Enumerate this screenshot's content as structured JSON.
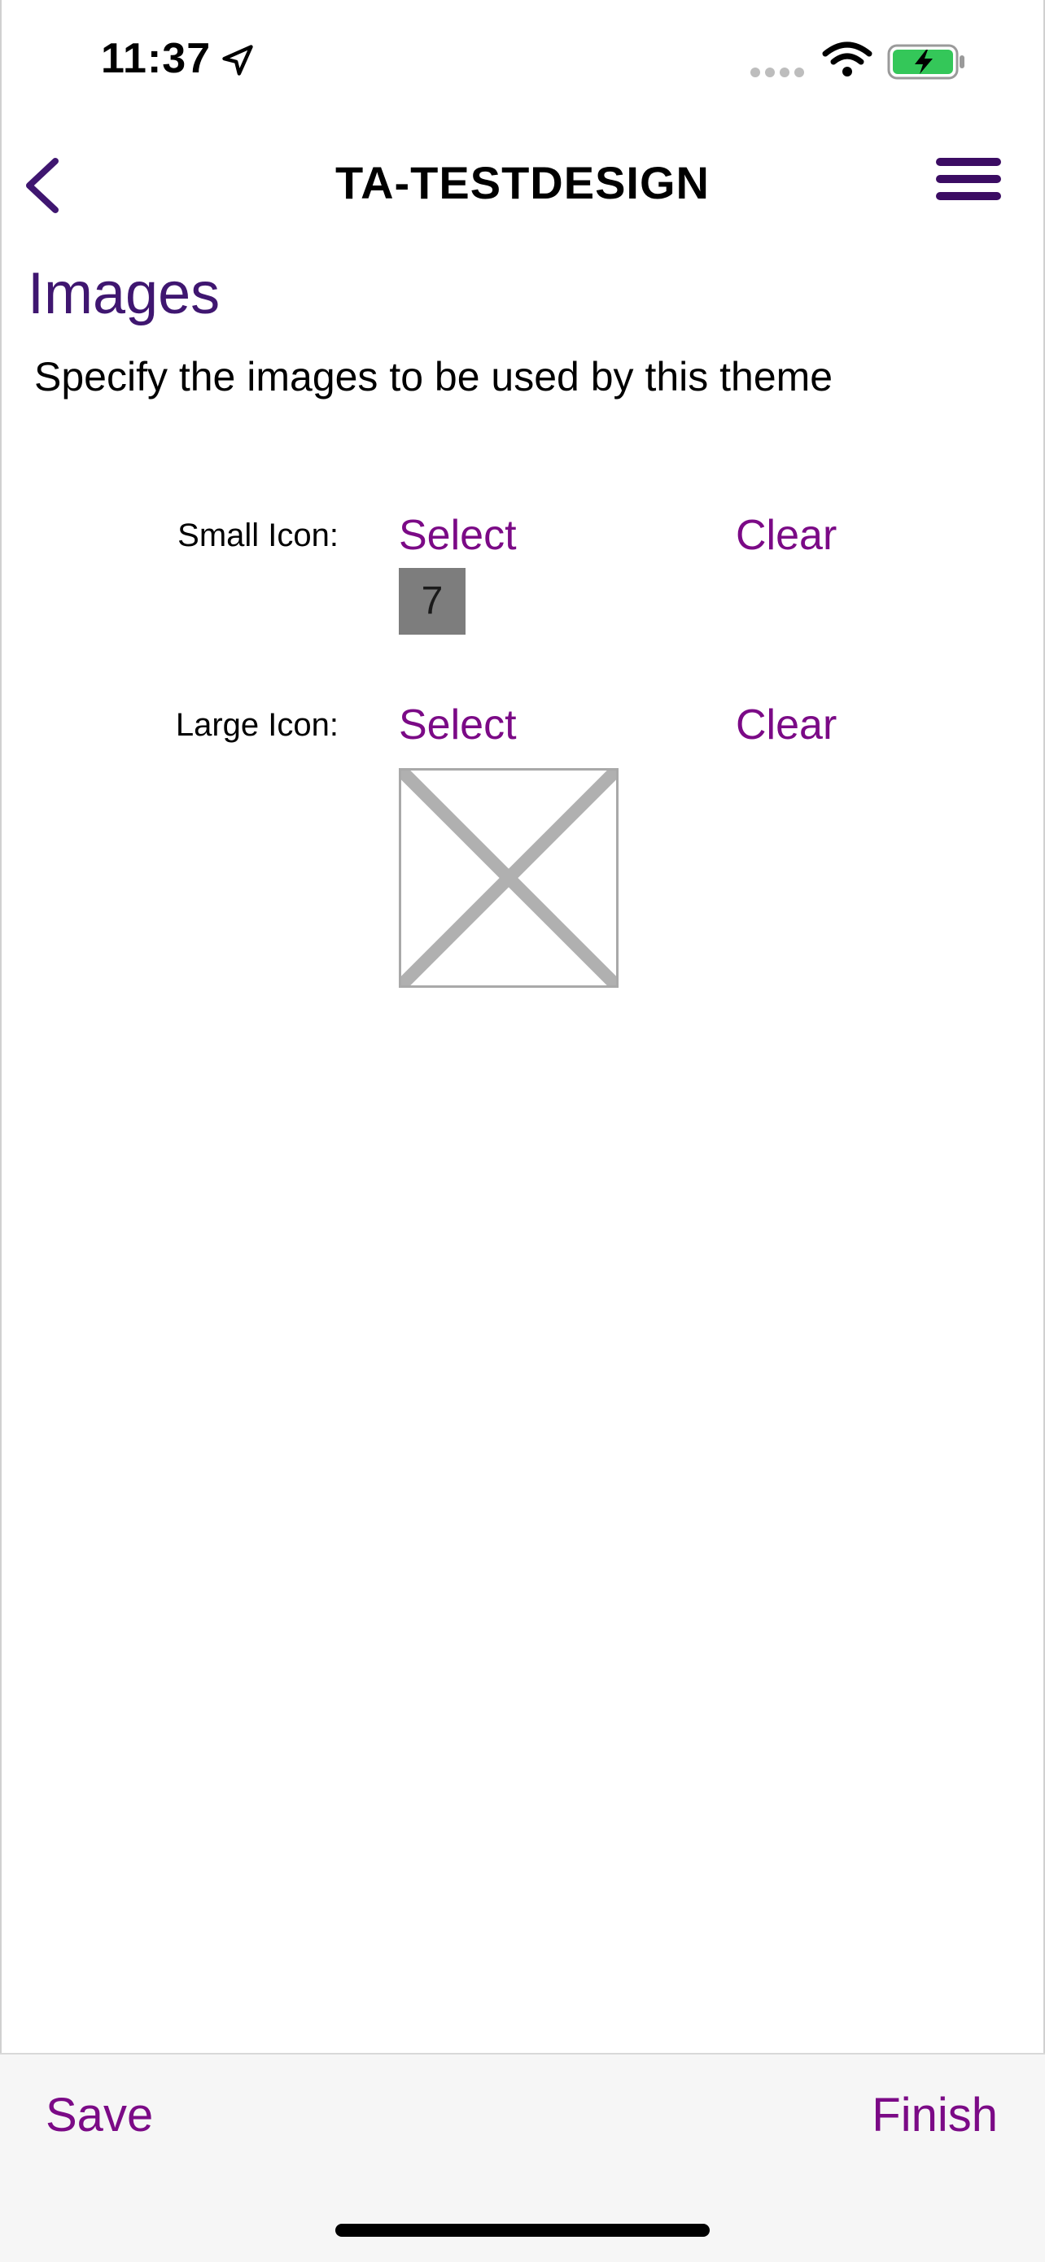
{
  "status_bar": {
    "time": "11:37",
    "icons": [
      "location-arrow-icon",
      "signal-icon",
      "wifi-icon",
      "battery-charging-icon"
    ]
  },
  "nav": {
    "title": "TA-TESTDESIGN",
    "back_icon": "chevron-left-icon",
    "menu_icon": "hamburger-menu-icon"
  },
  "section": {
    "heading": "Images",
    "description": "Specify the images to be used by this theme"
  },
  "image_rows": [
    {
      "label": "Small Icon:",
      "select_label": "Select",
      "clear_label": "Clear",
      "preview_text": "7"
    },
    {
      "label": "Large Icon:",
      "select_label": "Select",
      "clear_label": "Clear",
      "preview_icon": "broken-image-icon"
    }
  ],
  "footer": {
    "save_label": "Save",
    "finish_label": "Finish"
  },
  "colors": {
    "accent": "#7b0a86",
    "heading": "#3f1670",
    "nav_icon": "#3b0c63",
    "battery_fill": "#34c759"
  }
}
